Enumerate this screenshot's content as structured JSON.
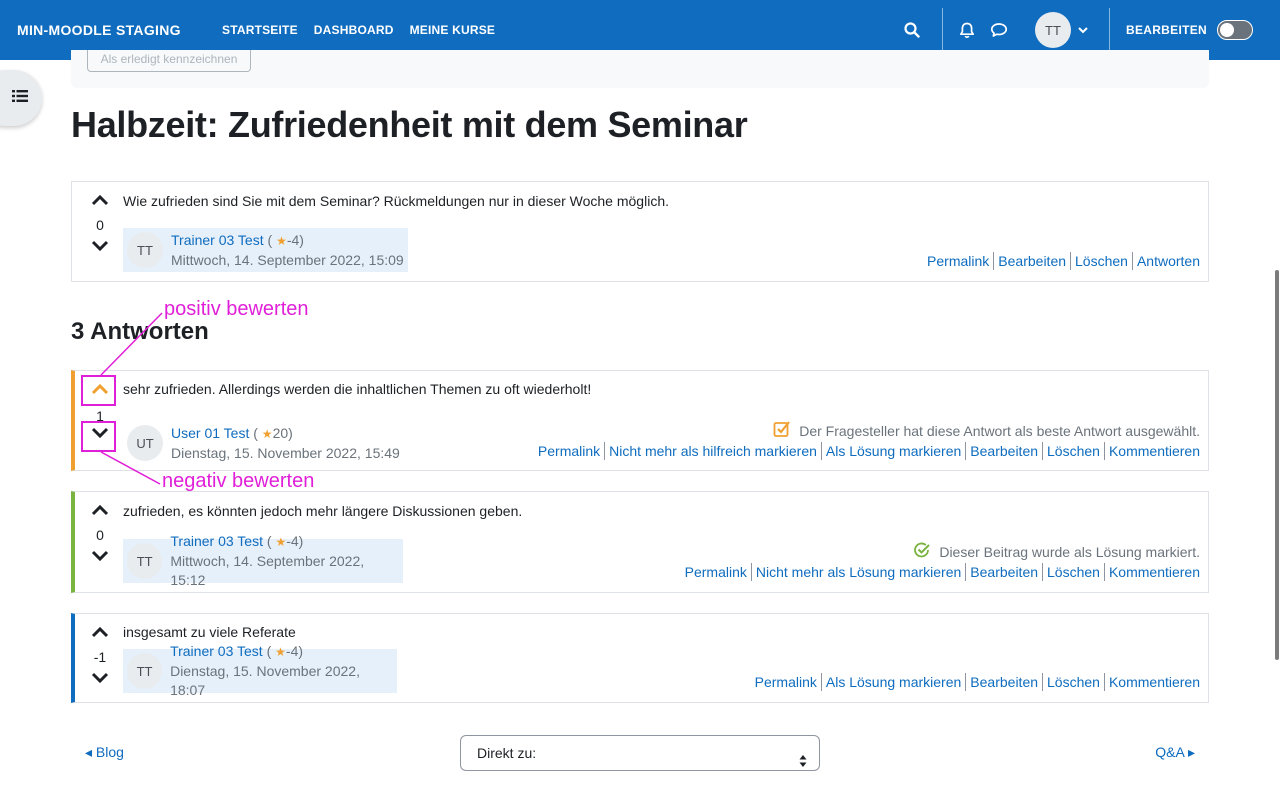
{
  "navbar": {
    "brand": "MIN-MOODLE STAGING",
    "links": [
      "STARTSEITE",
      "DASHBOARD",
      "MEINE KURSE"
    ],
    "user_initials": "TT",
    "edit_label": "BEARBEITEN",
    "edit_mode_on": false
  },
  "top_button": "Als erledigt kennzeichnen",
  "page_title": "Halbzeit: Zufriedenheit mit dem Seminar",
  "question": {
    "votes": "0",
    "text": "Wie zufrieden sind Sie mit dem Seminar? Rückmeldungen nur in dieser Woche möglich.",
    "author": {
      "initials": "TT",
      "name": "Trainer 03 Test",
      "points_open": "(",
      "points": "-4)",
      "date": "Mittwoch, 14. September 2022, 15:09"
    },
    "actions": [
      "Permalink",
      "Bearbeiten",
      "Löschen",
      "Antworten"
    ]
  },
  "answers_heading": "3 Antworten",
  "answers": [
    {
      "votes": "1",
      "text": "sehr zufrieden. Allerdings werden die inhaltlichen Themen zu oft wiederholt!",
      "author": {
        "initials": "UT",
        "name": "User 01 Test",
        "points_open": "(",
        "points": "20)",
        "date": "Dienstag, 15. November 2022, 15:49"
      },
      "status": "Der Fragesteller hat diese Antwort als beste Antwort ausgewählt.",
      "actions": [
        "Permalink",
        "Nicht mehr als hilfreich markieren",
        "Als Lösung markieren",
        "Bearbeiten",
        "Löschen",
        "Kommentieren"
      ]
    },
    {
      "votes": "0",
      "text": "zufrieden, es könnten jedoch mehr längere Diskussionen geben.",
      "author": {
        "initials": "TT",
        "name": "Trainer 03 Test",
        "points_open": "(",
        "points": "-4)",
        "date": "Mittwoch, 14. September 2022, 15:12"
      },
      "status": "Dieser Beitrag wurde als Lösung markiert.",
      "actions": [
        "Permalink",
        "Nicht mehr als Lösung markieren",
        "Bearbeiten",
        "Löschen",
        "Kommentieren"
      ]
    },
    {
      "votes": "-1",
      "text": "insgesamt zu viele Referate",
      "author": {
        "initials": "TT",
        "name": "Trainer 03 Test",
        "points_open": "(",
        "points": "-4)",
        "date": "Dienstag, 15. November 2022, 18:07"
      },
      "actions": [
        "Permalink",
        "Als Lösung markieren",
        "Bearbeiten",
        "Löschen",
        "Kommentieren"
      ]
    }
  ],
  "annotations": {
    "upvote": "positiv bewerten",
    "downvote": "negativ bewerten"
  },
  "bottom_nav": {
    "prev": "◂ Blog",
    "jump": "Direkt zu:",
    "next": "Q&A ▸"
  },
  "colors": {
    "primary": "#0f6cbf",
    "best_answer": "#f0a030",
    "solution": "#7ab33f",
    "annotation": "#e020d8"
  },
  "icons": [
    "search-icon",
    "bell-icon",
    "chat-icon",
    "chevron-down-icon",
    "list-icon",
    "chevron-up-icon",
    "star-icon",
    "checkbox-check-icon",
    "check-circle-icon"
  ]
}
